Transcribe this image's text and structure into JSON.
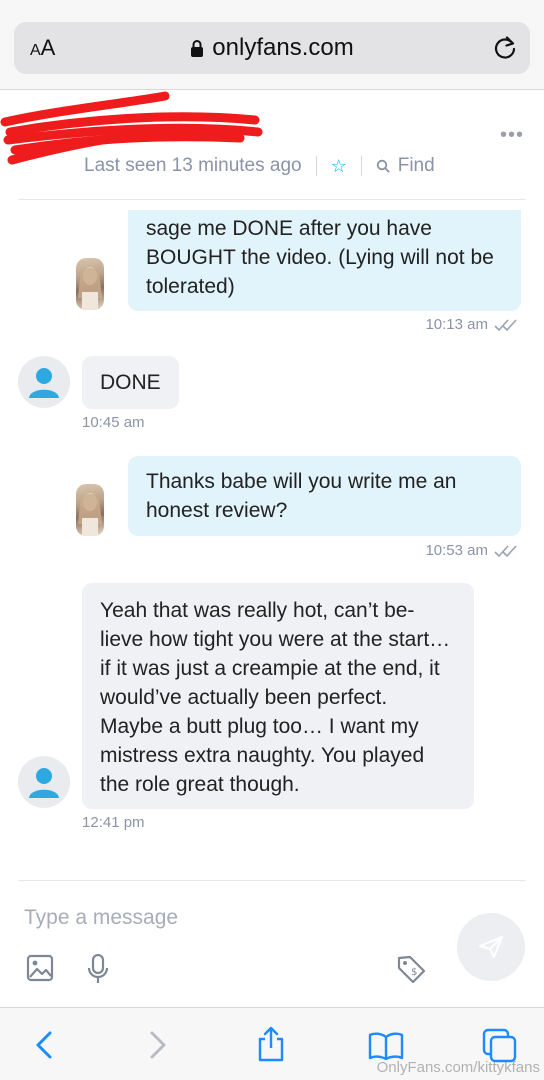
{
  "browser": {
    "aa_label_small": "A",
    "aa_label_large": "A",
    "url": "onlyfans.com"
  },
  "header": {
    "last_seen": "Last seen 13 minutes ago",
    "find_label": "Find",
    "more_icon": "more-dots-icon"
  },
  "messages": [
    {
      "direction": "out",
      "text": "sage me DONE after you have BOUGHT the video. (Lying will not be tolerated)",
      "time": "10:13 am"
    },
    {
      "direction": "in",
      "text": "DONE",
      "time": "10:45 am"
    },
    {
      "direction": "out",
      "text": "Thanks babe will you write me an honest review?",
      "time": "10:53 am"
    },
    {
      "direction": "in",
      "text": "Yeah that was really hot, can’t be-lieve how tight you were at the start… if it was just a creampie at the end, it would’ve actually been perfect. Maybe a butt plug too… I want my mistress extra naughty. You played the role great though.",
      "time": "12:41 pm"
    }
  ],
  "composer": {
    "placeholder": "Type a message"
  },
  "watermark": "OnlyFans.com/kittykfans",
  "colors": {
    "accent": "#00aff0",
    "outgoing_bubble": "#e1f3fb",
    "incoming_bubble": "#f0f1f4",
    "muted_text": "#8a94a6"
  }
}
